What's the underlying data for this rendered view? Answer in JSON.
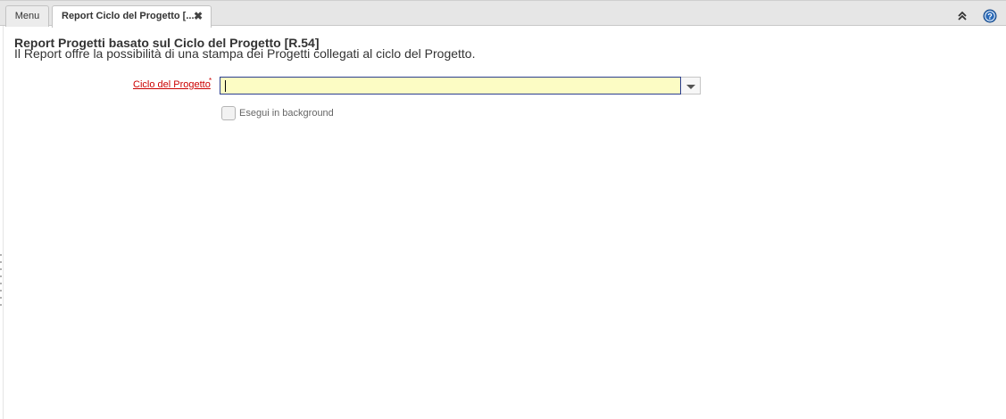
{
  "tabs": {
    "menu_label": "Menu",
    "active_label": "Report Ciclo del Progetto [...",
    "close_glyph": "✖"
  },
  "toolbar": {
    "collapse_icon": "double-chevron-up-icon",
    "help_icon": "help-icon"
  },
  "report": {
    "title": "Report Progetti basato sul Ciclo del Progetto [R.54]",
    "description": "Il Report offre la possibilità di una stampa dei Progetti collegati al ciclo del Progetto."
  },
  "form": {
    "field_label": "Ciclo del Progetto",
    "required_mark": "*",
    "field_value": "",
    "background_label": "Esegui in background",
    "background_checked": false
  },
  "colors": {
    "required_label": "#cc0000",
    "input_bg": "#fcfcc4",
    "input_border": "#2b3e8e",
    "help_blue": "#2a6ab8"
  }
}
